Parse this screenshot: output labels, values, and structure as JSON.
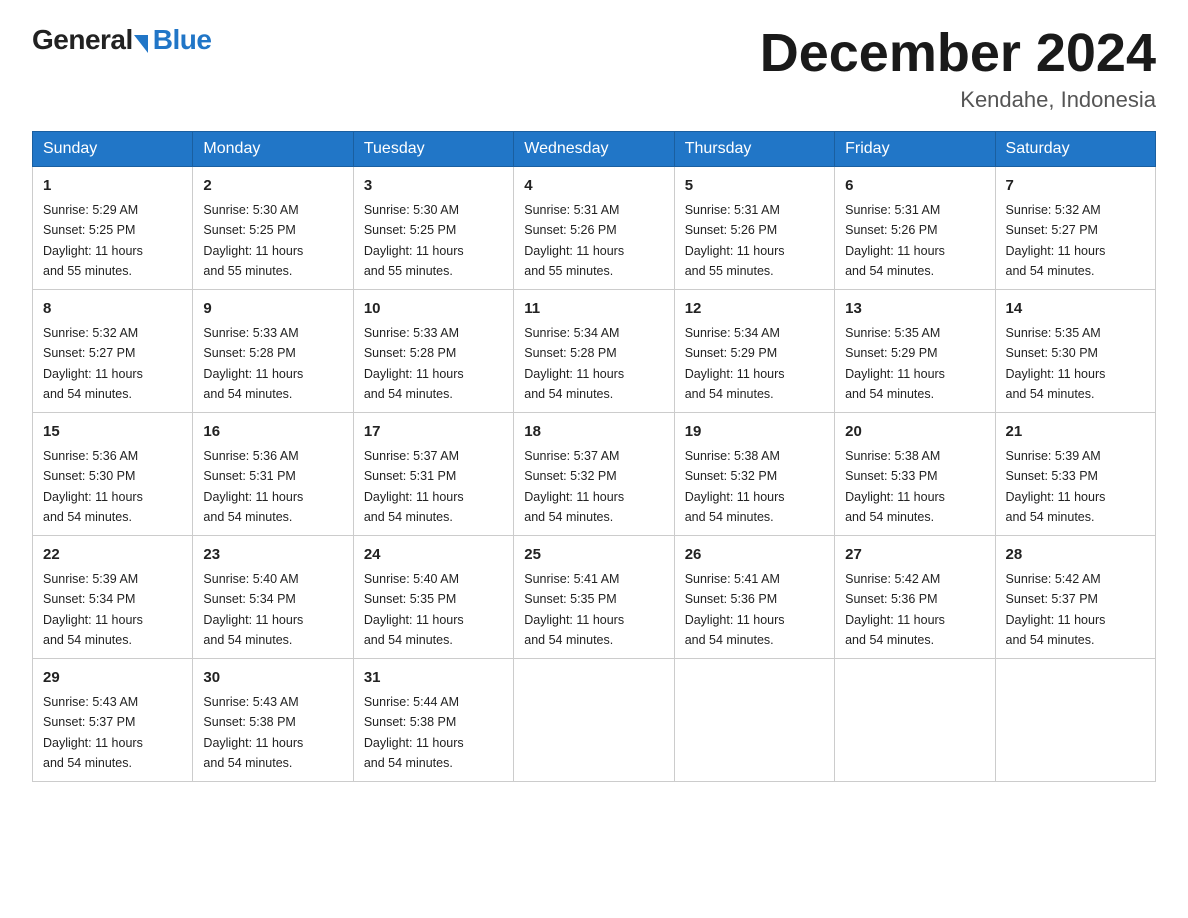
{
  "header": {
    "logo_general": "General",
    "logo_blue": "Blue",
    "month_title": "December 2024",
    "location": "Kendahe, Indonesia"
  },
  "weekdays": [
    "Sunday",
    "Monday",
    "Tuesday",
    "Wednesday",
    "Thursday",
    "Friday",
    "Saturday"
  ],
  "weeks": [
    [
      {
        "day": "1",
        "sunrise": "5:29 AM",
        "sunset": "5:25 PM",
        "daylight": "11 hours and 55 minutes."
      },
      {
        "day": "2",
        "sunrise": "5:30 AM",
        "sunset": "5:25 PM",
        "daylight": "11 hours and 55 minutes."
      },
      {
        "day": "3",
        "sunrise": "5:30 AM",
        "sunset": "5:25 PM",
        "daylight": "11 hours and 55 minutes."
      },
      {
        "day": "4",
        "sunrise": "5:31 AM",
        "sunset": "5:26 PM",
        "daylight": "11 hours and 55 minutes."
      },
      {
        "day": "5",
        "sunrise": "5:31 AM",
        "sunset": "5:26 PM",
        "daylight": "11 hours and 55 minutes."
      },
      {
        "day": "6",
        "sunrise": "5:31 AM",
        "sunset": "5:26 PM",
        "daylight": "11 hours and 54 minutes."
      },
      {
        "day": "7",
        "sunrise": "5:32 AM",
        "sunset": "5:27 PM",
        "daylight": "11 hours and 54 minutes."
      }
    ],
    [
      {
        "day": "8",
        "sunrise": "5:32 AM",
        "sunset": "5:27 PM",
        "daylight": "11 hours and 54 minutes."
      },
      {
        "day": "9",
        "sunrise": "5:33 AM",
        "sunset": "5:28 PM",
        "daylight": "11 hours and 54 minutes."
      },
      {
        "day": "10",
        "sunrise": "5:33 AM",
        "sunset": "5:28 PM",
        "daylight": "11 hours and 54 minutes."
      },
      {
        "day": "11",
        "sunrise": "5:34 AM",
        "sunset": "5:28 PM",
        "daylight": "11 hours and 54 minutes."
      },
      {
        "day": "12",
        "sunrise": "5:34 AM",
        "sunset": "5:29 PM",
        "daylight": "11 hours and 54 minutes."
      },
      {
        "day": "13",
        "sunrise": "5:35 AM",
        "sunset": "5:29 PM",
        "daylight": "11 hours and 54 minutes."
      },
      {
        "day": "14",
        "sunrise": "5:35 AM",
        "sunset": "5:30 PM",
        "daylight": "11 hours and 54 minutes."
      }
    ],
    [
      {
        "day": "15",
        "sunrise": "5:36 AM",
        "sunset": "5:30 PM",
        "daylight": "11 hours and 54 minutes."
      },
      {
        "day": "16",
        "sunrise": "5:36 AM",
        "sunset": "5:31 PM",
        "daylight": "11 hours and 54 minutes."
      },
      {
        "day": "17",
        "sunrise": "5:37 AM",
        "sunset": "5:31 PM",
        "daylight": "11 hours and 54 minutes."
      },
      {
        "day": "18",
        "sunrise": "5:37 AM",
        "sunset": "5:32 PM",
        "daylight": "11 hours and 54 minutes."
      },
      {
        "day": "19",
        "sunrise": "5:38 AM",
        "sunset": "5:32 PM",
        "daylight": "11 hours and 54 minutes."
      },
      {
        "day": "20",
        "sunrise": "5:38 AM",
        "sunset": "5:33 PM",
        "daylight": "11 hours and 54 minutes."
      },
      {
        "day": "21",
        "sunrise": "5:39 AM",
        "sunset": "5:33 PM",
        "daylight": "11 hours and 54 minutes."
      }
    ],
    [
      {
        "day": "22",
        "sunrise": "5:39 AM",
        "sunset": "5:34 PM",
        "daylight": "11 hours and 54 minutes."
      },
      {
        "day": "23",
        "sunrise": "5:40 AM",
        "sunset": "5:34 PM",
        "daylight": "11 hours and 54 minutes."
      },
      {
        "day": "24",
        "sunrise": "5:40 AM",
        "sunset": "5:35 PM",
        "daylight": "11 hours and 54 minutes."
      },
      {
        "day": "25",
        "sunrise": "5:41 AM",
        "sunset": "5:35 PM",
        "daylight": "11 hours and 54 minutes."
      },
      {
        "day": "26",
        "sunrise": "5:41 AM",
        "sunset": "5:36 PM",
        "daylight": "11 hours and 54 minutes."
      },
      {
        "day": "27",
        "sunrise": "5:42 AM",
        "sunset": "5:36 PM",
        "daylight": "11 hours and 54 minutes."
      },
      {
        "day": "28",
        "sunrise": "5:42 AM",
        "sunset": "5:37 PM",
        "daylight": "11 hours and 54 minutes."
      }
    ],
    [
      {
        "day": "29",
        "sunrise": "5:43 AM",
        "sunset": "5:37 PM",
        "daylight": "11 hours and 54 minutes."
      },
      {
        "day": "30",
        "sunrise": "5:43 AM",
        "sunset": "5:38 PM",
        "daylight": "11 hours and 54 minutes."
      },
      {
        "day": "31",
        "sunrise": "5:44 AM",
        "sunset": "5:38 PM",
        "daylight": "11 hours and 54 minutes."
      },
      null,
      null,
      null,
      null
    ]
  ],
  "labels": {
    "sunrise": "Sunrise:",
    "sunset": "Sunset:",
    "daylight": "Daylight:"
  }
}
